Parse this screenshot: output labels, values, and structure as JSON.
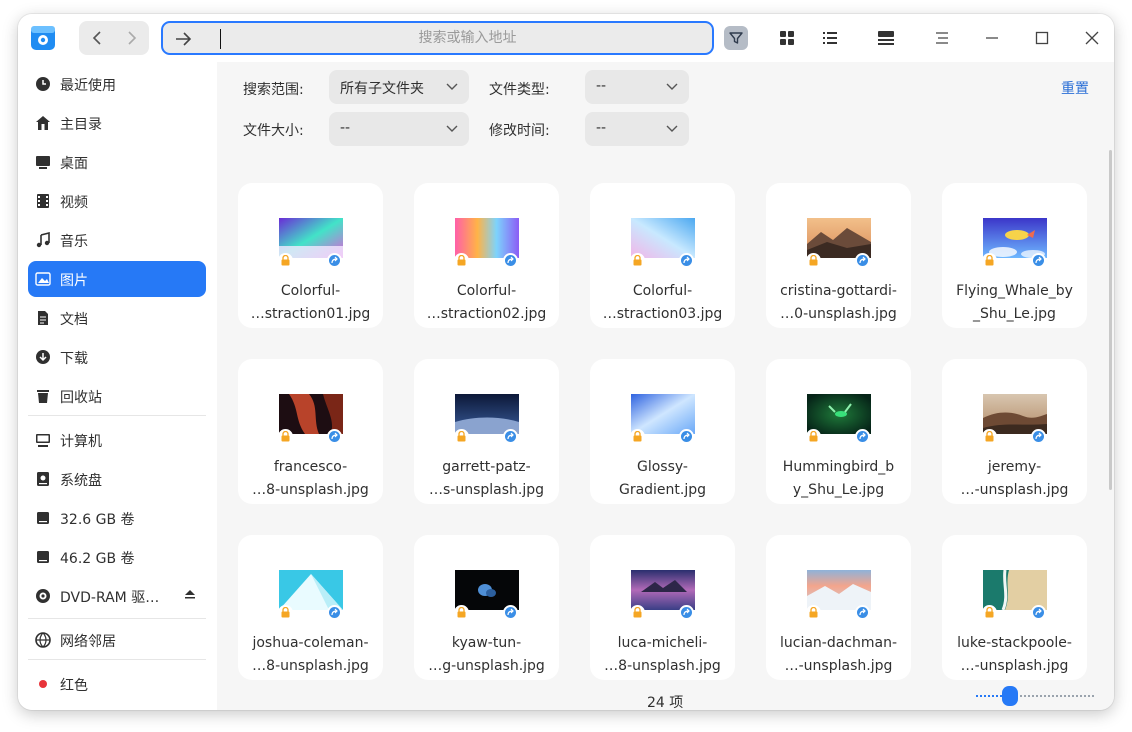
{
  "titlebar": {
    "nav_back_icon": "chevron-left-icon",
    "nav_forward_icon": "chevron-right-icon",
    "address_placeholder": "搜索或输入地址",
    "address_value": "",
    "filter_icon": "funnel-icon"
  },
  "sidebar": {
    "items": [
      {
        "label": "最近使用",
        "icon": "clock-icon"
      },
      {
        "label": "主目录",
        "icon": "home-icon"
      },
      {
        "label": "桌面",
        "icon": "desktop-icon"
      },
      {
        "label": "视频",
        "icon": "film-icon"
      },
      {
        "label": "音乐",
        "icon": "music-icon"
      },
      {
        "label": "图片",
        "icon": "image-icon",
        "active": true
      },
      {
        "label": "文档",
        "icon": "document-icon"
      },
      {
        "label": "下载",
        "icon": "download-icon"
      },
      {
        "label": "回收站",
        "icon": "trash-icon"
      },
      {
        "label": "计算机",
        "icon": "computer-icon"
      },
      {
        "label": "系统盘",
        "icon": "system-disk-icon"
      },
      {
        "label": "32.6 GB 卷",
        "icon": "drive-icon"
      },
      {
        "label": "46.2 GB 卷",
        "icon": "drive-icon"
      },
      {
        "label": "DVD-RAM 驱…",
        "icon": "disc-icon"
      },
      {
        "label": "网络邻居",
        "icon": "network-icon"
      },
      {
        "label": "红色",
        "icon": "red-tag-icon"
      }
    ]
  },
  "filters": {
    "scope_label": "搜索范围:",
    "scope_value": "所有子文件夹",
    "type_label": "文件类型:",
    "type_value": "--",
    "size_label": "文件大小:",
    "size_value": "--",
    "mtime_label": "修改时间:",
    "mtime_value": "--",
    "reset_label": "重置"
  },
  "files": [
    {
      "line1": "Colorful-",
      "line2": "…straction01.jpg",
      "thumb": "aurora"
    },
    {
      "line1": "Colorful-",
      "line2": "…straction02.jpg",
      "thumb": "rainbow"
    },
    {
      "line1": "Colorful-",
      "line2": "…straction03.jpg",
      "thumb": "pastel"
    },
    {
      "line1": "cristina-gottardi-",
      "line2": "…0-unsplash.jpg",
      "thumb": "mountain"
    },
    {
      "line1": "Flying_Whale_by",
      "line2": "_Shu_Le.jpg",
      "thumb": "whale"
    },
    {
      "line1": "francesco-",
      "line2": "…8-unsplash.jpg",
      "thumb": "canyon"
    },
    {
      "line1": "garrett-patz-",
      "line2": "…s-unsplash.jpg",
      "thumb": "dunes-blue"
    },
    {
      "line1": "Glossy-",
      "line2": "Gradient.jpg",
      "thumb": "glossy"
    },
    {
      "line1": "Hummingbird_b",
      "line2": "y_Shu_Le.jpg",
      "thumb": "hummingbird"
    },
    {
      "line1": "jeremy-",
      "line2": "…-unsplash.jpg",
      "thumb": "desert"
    },
    {
      "line1": "joshua-coleman-",
      "line2": "…8-unsplash.jpg",
      "thumb": "building"
    },
    {
      "line1": "kyaw-tun-",
      "line2": "…g-unsplash.jpg",
      "thumb": "flower"
    },
    {
      "line1": "luca-micheli-",
      "line2": "…8-unsplash.jpg",
      "thumb": "lake"
    },
    {
      "line1": "lucian-dachman-",
      "line2": "…-unsplash.jpg",
      "thumb": "snow"
    },
    {
      "line1": "luke-stackpoole-",
      "line2": "…-unsplash.jpg",
      "thumb": "coast"
    }
  ],
  "status": {
    "count_label": "24 项"
  },
  "icon_size_level": 0.3,
  "colors": {
    "accent": "#2679f6",
    "lock_badge": "#f5a623",
    "link_badge": "#3a8ee6",
    "red_tag": "#e8343a"
  }
}
